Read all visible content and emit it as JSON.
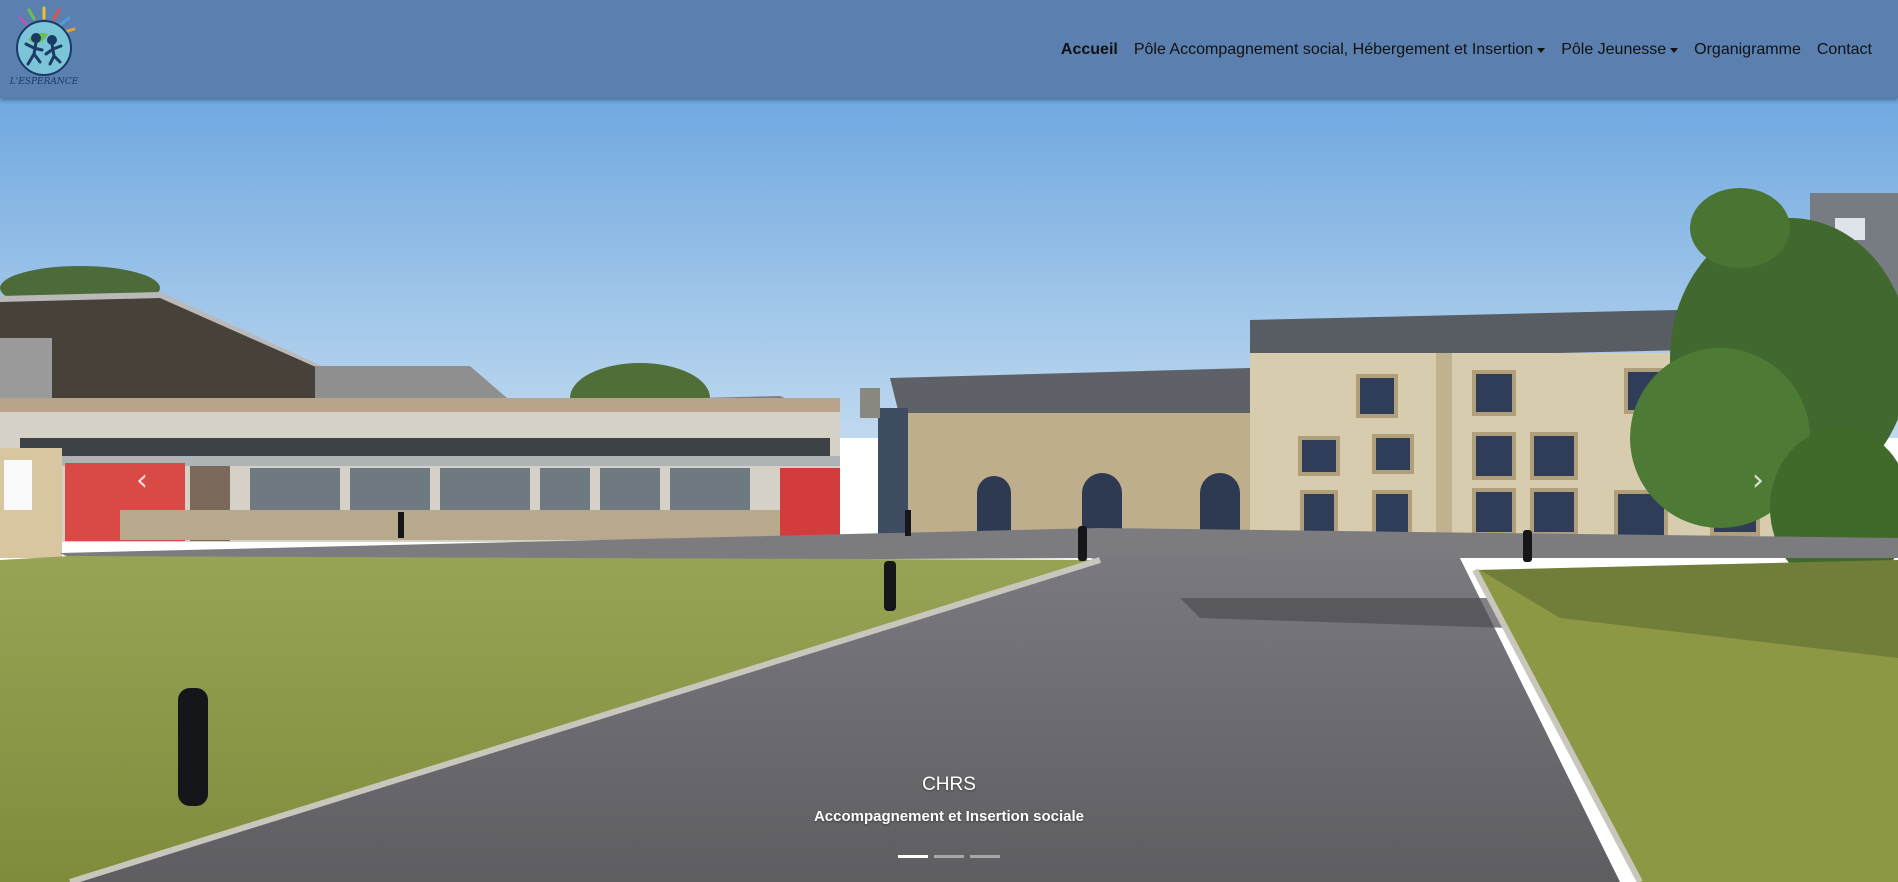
{
  "logo": {
    "text": "L'ESPERANCE"
  },
  "nav": {
    "items": [
      {
        "label": "Accueil",
        "active": true,
        "dropdown": false
      },
      {
        "label": "Pôle Accompagnement social, Hébergement et Insertion",
        "active": false,
        "dropdown": true
      },
      {
        "label": "Pôle Jeunesse",
        "active": false,
        "dropdown": true
      },
      {
        "label": "Organigramme",
        "active": false,
        "dropdown": false
      },
      {
        "label": "Contact",
        "active": false,
        "dropdown": false
      }
    ]
  },
  "carousel": {
    "slide_title": "CHRS",
    "slide_subtitle": "Accompagnement et Insertion sociale",
    "prev_icon": "chevron-left-icon",
    "next_icon": "chevron-right-icon",
    "slide_count": 3,
    "active_index": 0
  },
  "colors": {
    "navbar": "#5b7faf",
    "sky": "#8ebde9",
    "lawn": "#8a9a45",
    "road": "#6c6c70"
  }
}
